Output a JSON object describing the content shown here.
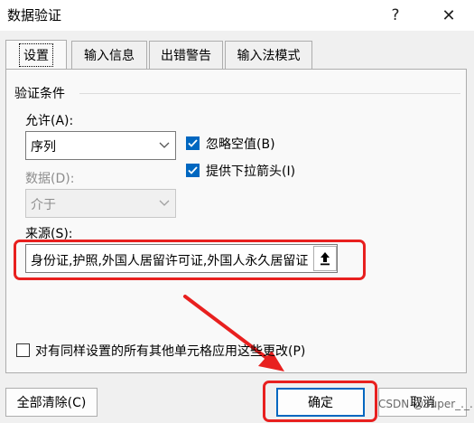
{
  "window": {
    "title": "数据验证",
    "help_glyph": "?",
    "close_glyph": "✕"
  },
  "tabs": [
    {
      "label": "设置",
      "active": true
    },
    {
      "label": "输入信息",
      "active": false
    },
    {
      "label": "出错警告",
      "active": false
    },
    {
      "label": "输入法模式",
      "active": false
    }
  ],
  "validation": {
    "group_label": "验证条件",
    "allow_label": "允许(A):",
    "allow_value": "序列",
    "data_label": "数据(D):",
    "data_value": "介于",
    "source_label": "来源(S):",
    "source_value": "身份证,护照,外国人居留许可证,外国人永久居留证"
  },
  "options": {
    "ignore_blank": {
      "label": "忽略空值(B)",
      "checked": true
    },
    "in_cell_dropdown": {
      "label": "提供下拉箭头(I)",
      "checked": true
    },
    "apply_all": {
      "label": "对有同样设置的所有其他单元格应用这些更改(P)",
      "checked": false
    }
  },
  "footer": {
    "clear_all": "全部清除(C)",
    "ok": "确定",
    "cancel": "取消"
  },
  "watermark": "CSDN @Super_._.",
  "colors": {
    "accent": "#0067c0",
    "annotation": "#e8201f"
  }
}
